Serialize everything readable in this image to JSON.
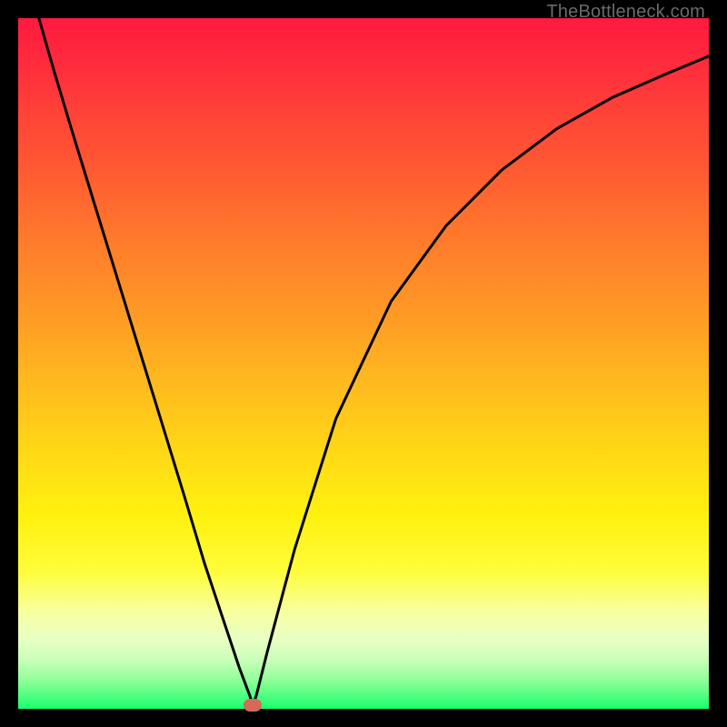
{
  "watermark": "TheBottleneck.com",
  "chart_data": {
    "type": "line",
    "title": "",
    "xlabel": "",
    "ylabel": "",
    "xlim": [
      0,
      100
    ],
    "ylim": [
      0,
      100
    ],
    "grid": false,
    "legend": false,
    "series": [
      {
        "name": "curve",
        "x": [
          3,
          5,
          8,
          12,
          16,
          20,
          24,
          27,
          30,
          32,
          33.5,
          34,
          34.5,
          36,
          40,
          46,
          54,
          62,
          70,
          78,
          86,
          94,
          100
        ],
        "y": [
          100,
          93,
          83,
          70,
          57,
          44,
          31,
          21,
          12,
          6,
          2,
          0.5,
          2,
          8,
          23,
          42,
          59,
          70,
          78,
          84,
          88.5,
          92,
          94.5
        ]
      }
    ],
    "marker": {
      "x": 34,
      "y": 0.5,
      "color": "#d46a5a"
    },
    "gradient_stops": [
      {
        "pct": 0,
        "color": "#ff1a3f"
      },
      {
        "pct": 50,
        "color": "#ffb71f"
      },
      {
        "pct": 75,
        "color": "#fff10f"
      },
      {
        "pct": 100,
        "color": "#18ff6e"
      }
    ]
  }
}
